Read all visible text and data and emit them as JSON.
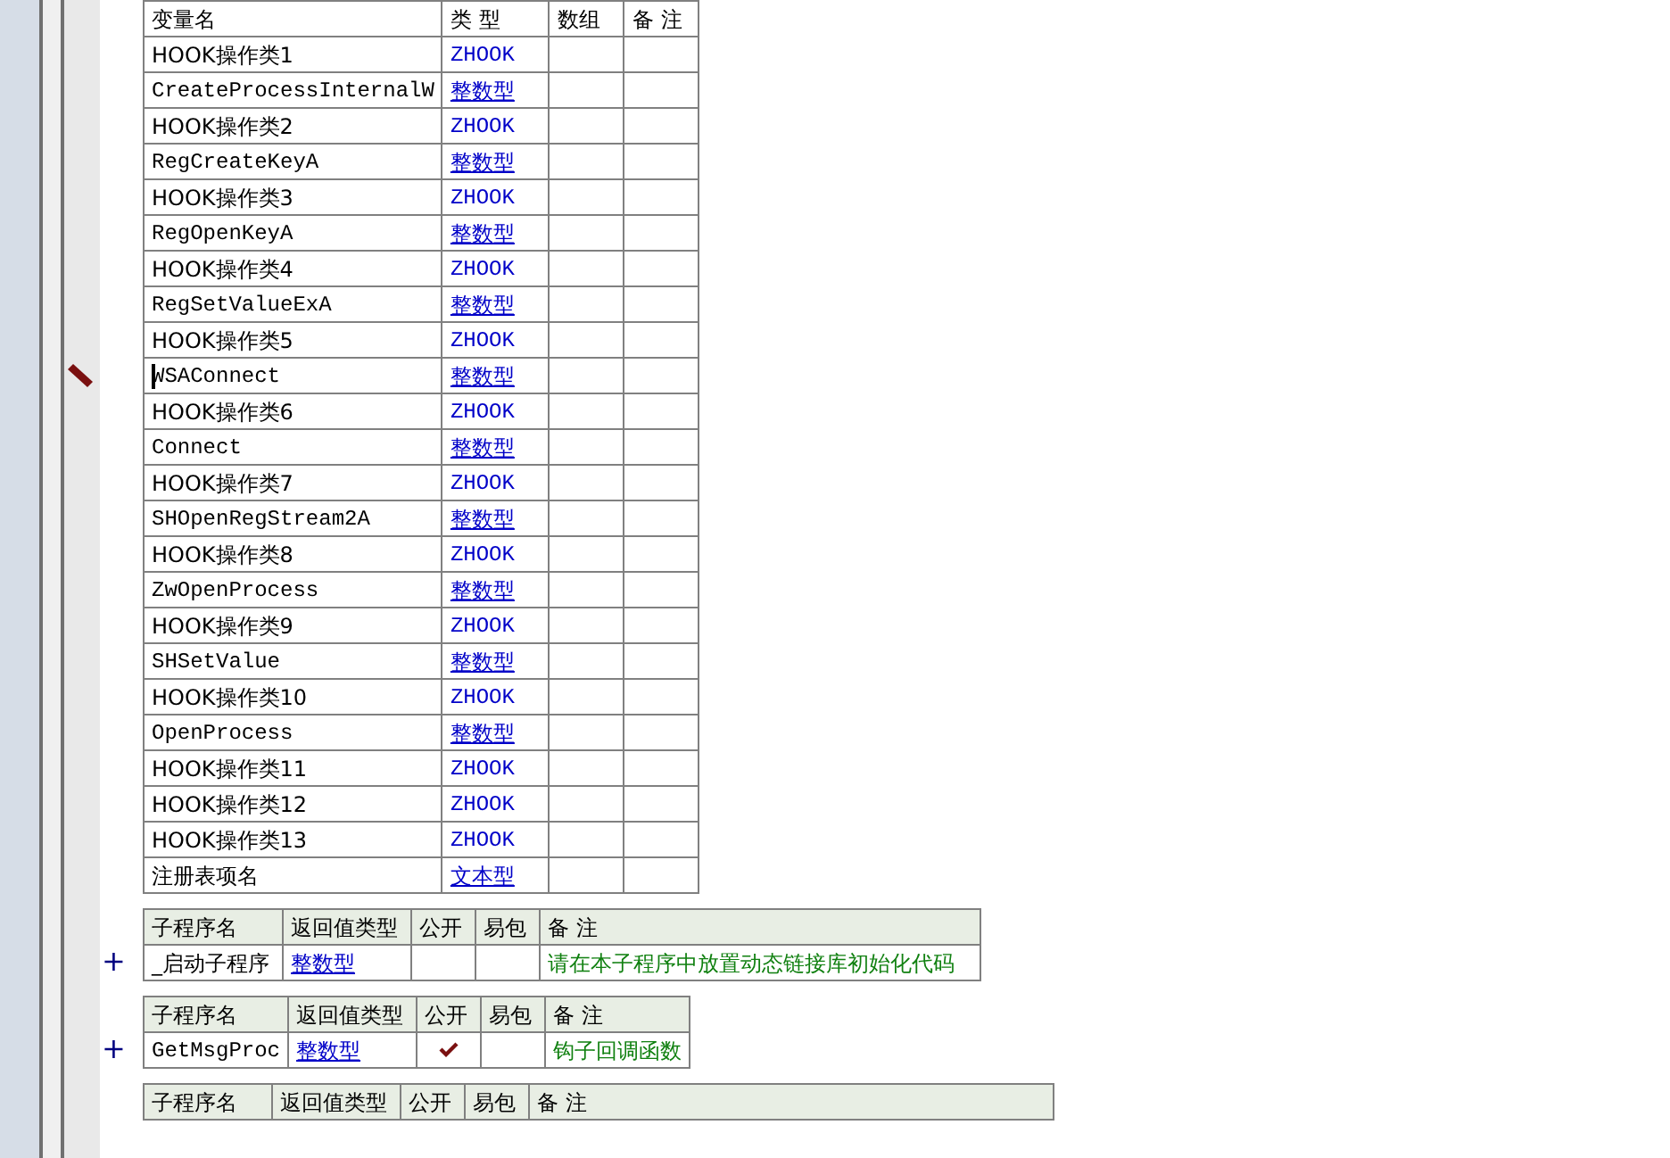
{
  "variables": {
    "columns": [
      "变量名",
      "类 型",
      "数组",
      "备 注"
    ],
    "rows": [
      {
        "name": "HOOK操作类1",
        "type": "ZHOOK",
        "underlined": false,
        "editing": false
      },
      {
        "name": "CreateProcessInternalW",
        "type": "整数型",
        "underlined": true,
        "editing": false
      },
      {
        "name": "HOOK操作类2",
        "type": "ZHOOK",
        "underlined": false,
        "editing": false
      },
      {
        "name": "RegCreateKeyA",
        "type": "整数型",
        "underlined": true,
        "editing": false
      },
      {
        "name": "HOOK操作类3",
        "type": "ZHOOK",
        "underlined": false,
        "editing": false
      },
      {
        "name": "RegOpenKeyA",
        "type": "整数型",
        "underlined": true,
        "editing": false
      },
      {
        "name": "HOOK操作类4",
        "type": "ZHOOK",
        "underlined": false,
        "editing": false
      },
      {
        "name": "RegSetValueExA",
        "type": "整数型",
        "underlined": true,
        "editing": false
      },
      {
        "name": "HOOK操作类5",
        "type": "ZHOOK",
        "underlined": false,
        "editing": false
      },
      {
        "name": "WSAConnect",
        "type": "整数型",
        "underlined": true,
        "editing": true
      },
      {
        "name": "HOOK操作类6",
        "type": "ZHOOK",
        "underlined": false,
        "editing": false
      },
      {
        "name": "Connect",
        "type": "整数型",
        "underlined": true,
        "editing": false
      },
      {
        "name": "HOOK操作类7",
        "type": "ZHOOK",
        "underlined": false,
        "editing": false
      },
      {
        "name": "SHOpenRegStream2A",
        "type": "整数型",
        "underlined": true,
        "editing": false
      },
      {
        "name": "HOOK操作类8",
        "type": "ZHOOK",
        "underlined": false,
        "editing": false
      },
      {
        "name": "ZwOpenProcess",
        "type": "整数型",
        "underlined": true,
        "editing": false
      },
      {
        "name": "HOOK操作类9",
        "type": "ZHOOK",
        "underlined": false,
        "editing": false
      },
      {
        "name": "SHSetValue",
        "type": "整数型",
        "underlined": true,
        "editing": false
      },
      {
        "name": "HOOK操作类10",
        "type": "ZHOOK",
        "underlined": false,
        "editing": false
      },
      {
        "name": "OpenProcess",
        "type": "整数型",
        "underlined": true,
        "editing": false
      },
      {
        "name": "HOOK操作类11",
        "type": "ZHOOK",
        "underlined": false,
        "editing": false
      },
      {
        "name": "HOOK操作类12",
        "type": "ZHOOK",
        "underlined": false,
        "editing": false
      },
      {
        "name": "HOOK操作类13",
        "type": "ZHOOK",
        "underlined": false,
        "editing": false
      },
      {
        "name": "注册表项名",
        "type": "文本型",
        "underlined": true,
        "editing": false
      }
    ]
  },
  "subroutines": [
    {
      "columns": [
        "子程序名",
        "返回值类型",
        "公开",
        "易包",
        "备 注"
      ],
      "expander": "+",
      "row": {
        "name": "_启动子程序",
        "return_type": "整数型",
        "public": false,
        "remark": "请在本子程序中放置动态链接库初始化代码"
      }
    },
    {
      "columns": [
        "子程序名",
        "返回值类型",
        "公开",
        "易包",
        "备 注"
      ],
      "expander": "+",
      "row": {
        "name": "GetMsgProc",
        "return_type": "整数型",
        "public": true,
        "remark": "钩子回调函数"
      }
    },
    {
      "columns": [
        "子程序名",
        "返回值类型",
        "公开",
        "易包",
        "备 注"
      ]
    }
  ]
}
